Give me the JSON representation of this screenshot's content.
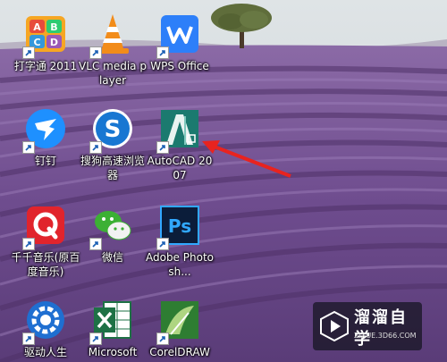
{
  "desktop": {
    "icons": [
      {
        "label": "打字通 2011",
        "icon": "typing-app-icon"
      },
      {
        "label": "VLC media player",
        "icon": "vlc-cone-icon"
      },
      {
        "label": "WPS Office",
        "icon": "wps-icon"
      },
      {
        "label": "钉钉",
        "icon": "dingtalk-icon"
      },
      {
        "label": "搜狗高速浏览器",
        "icon": "sogou-browser-icon"
      },
      {
        "label": "AutoCAD 2007",
        "icon": "autocad-icon"
      },
      {
        "label": "千千音乐(原百度音乐)",
        "icon": "qianqian-music-icon"
      },
      {
        "label": "微信",
        "icon": "wechat-icon"
      },
      {
        "label": "Adobe Photosh...",
        "icon": "photoshop-icon"
      },
      {
        "label": "驱动人生",
        "icon": "driver-life-icon"
      },
      {
        "label": "Microsoft",
        "icon": "excel-icon"
      },
      {
        "label": "CorelDRAW",
        "icon": "coreldraw-icon"
      }
    ]
  },
  "watermark": {
    "title": "溜溜自学",
    "url": "ZIXUE.3D66.COM"
  },
  "colors": {
    "field_purple": "#7d5a9e",
    "sky": "#cfd6dc",
    "arrow_red": "#e8231f"
  }
}
